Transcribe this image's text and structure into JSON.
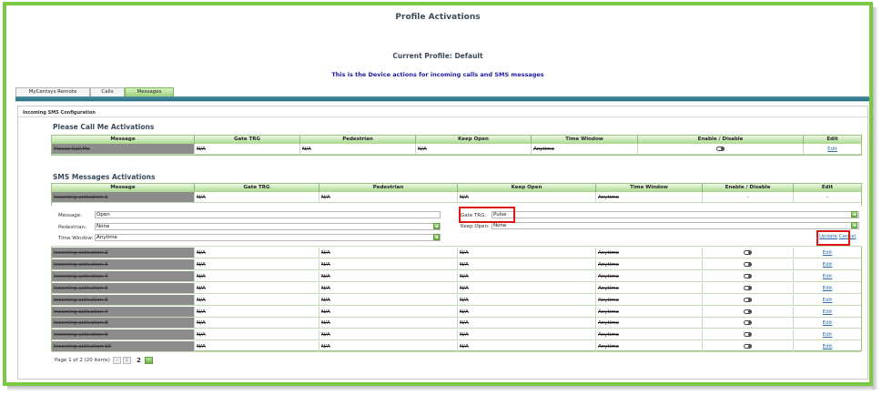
{
  "page": {
    "title": "Profile Activations",
    "current_profile": "Current Profile: Default",
    "description": "This is the Device actions for incoming calls and SMS messages"
  },
  "tabs": [
    {
      "label": "MyCentsys Remote",
      "active": false
    },
    {
      "label": "Calls",
      "active": false
    },
    {
      "label": "Messages",
      "active": true
    }
  ],
  "panel": {
    "title": "Incoming SMS Configuration"
  },
  "call_me": {
    "title": "Please Call Me Activations",
    "headers": [
      "Message",
      "Gate TRG",
      "Pedestrian",
      "Keep Open",
      "Time Window",
      "Enable / Disable",
      "Edit"
    ],
    "rows": [
      {
        "message": "Please Call Me",
        "gate": "N/A",
        "pedestrian": "N/A",
        "keep_open": "N/A",
        "time_window": "Anytime",
        "edit": "Edit"
      }
    ]
  },
  "sms": {
    "title": "SMS Messages Activations",
    "headers": [
      "Message",
      "Gate TRG",
      "Pedestrian",
      "Keep Open",
      "Time Window",
      "Enable / Disable",
      "Edit"
    ],
    "editing_row": {
      "message": "Incoming activation 1",
      "gate": "N/A",
      "pedestrian": "N/A",
      "keep_open": "N/A",
      "time_window": "Anytime",
      "enable": "-",
      "edit": "-"
    },
    "editor": {
      "message_label": "Message:",
      "message_value": "Open",
      "pedestrian_label": "Pedestrian:",
      "pedestrian_value": "None",
      "time_window_label": "Time Window:",
      "time_window_value": "Anytime",
      "gate_label": "Gate TRG:",
      "gate_value": "Pulse",
      "keep_open_label": "Keep Open:",
      "keep_open_value": "None",
      "update_label": "Update",
      "cancel_label": "Cancel"
    },
    "rows": [
      {
        "message": "Incoming activation 2",
        "gate": "N/A",
        "pedestrian": "N/A",
        "keep_open": "N/A",
        "time_window": "Anytime",
        "edit": "Edit"
      },
      {
        "message": "Incoming activation 3",
        "gate": "N/A",
        "pedestrian": "N/A",
        "keep_open": "N/A",
        "time_window": "Anytime",
        "edit": "Edit"
      },
      {
        "message": "Incoming activation 4",
        "gate": "N/A",
        "pedestrian": "N/A",
        "keep_open": "N/A",
        "time_window": "Anytime",
        "edit": "Edit"
      },
      {
        "message": "Incoming activation 5",
        "gate": "N/A",
        "pedestrian": "N/A",
        "keep_open": "N/A",
        "time_window": "Anytime",
        "edit": "Edit"
      },
      {
        "message": "Incoming activation 6",
        "gate": "N/A",
        "pedestrian": "N/A",
        "keep_open": "N/A",
        "time_window": "Anytime",
        "edit": "Edit"
      },
      {
        "message": "Incoming activation 7",
        "gate": "N/A",
        "pedestrian": "N/A",
        "keep_open": "N/A",
        "time_window": "Anytime",
        "edit": "Edit"
      },
      {
        "message": "Incoming activation 8",
        "gate": "N/A",
        "pedestrian": "N/A",
        "keep_open": "N/A",
        "time_window": "Anytime",
        "edit": "Edit"
      },
      {
        "message": "Incoming activation 9",
        "gate": "N/A",
        "pedestrian": "N/A",
        "keep_open": "N/A",
        "time_window": "Anytime",
        "edit": "Edit"
      },
      {
        "message": "Incoming activation 10",
        "gate": "N/A",
        "pedestrian": "N/A",
        "keep_open": "N/A",
        "time_window": "Anytime",
        "edit": "Edit"
      }
    ],
    "pager": {
      "summary": "Page 1 of 2 (20 items)",
      "current": "1",
      "next_page": "2"
    }
  },
  "icons": {
    "toggle": "toggle-switch-icon",
    "dropdown": "chevron-down-icon",
    "first": "first-page-icon",
    "prev": "prev-page-icon",
    "next": "next-page-icon"
  },
  "colors": {
    "accent_green": "#7ac943",
    "header_green": "#a9d88b",
    "tab_bar": "#2d6f82",
    "highlight_red": "#e01515",
    "link_blue": "#2a6bb0"
  }
}
